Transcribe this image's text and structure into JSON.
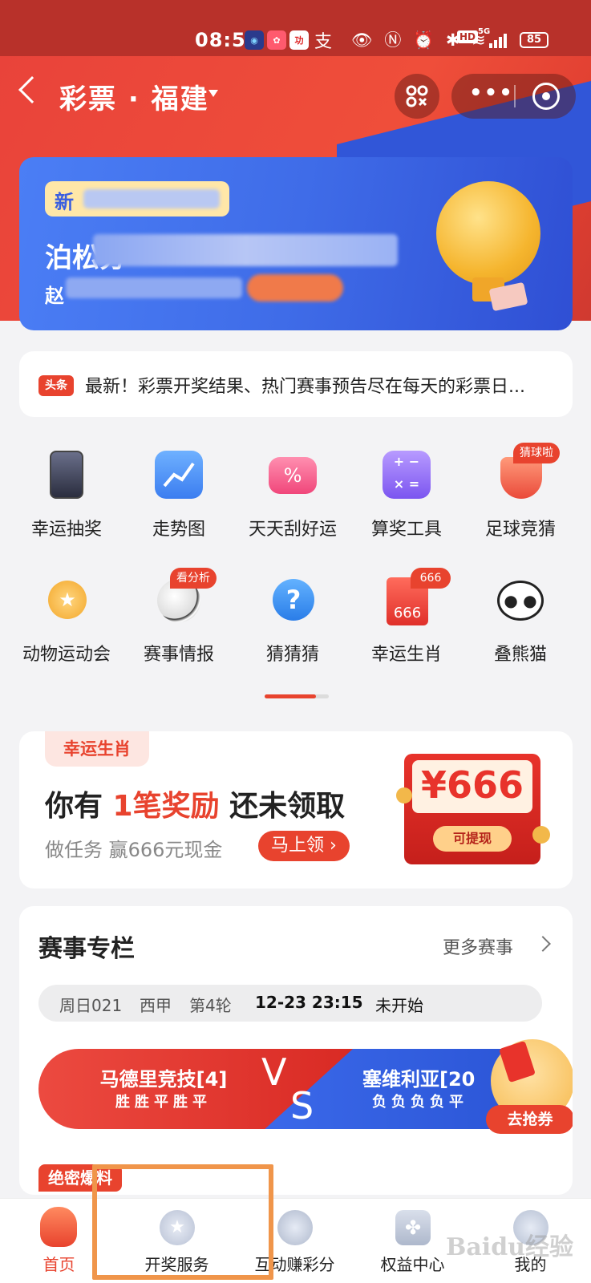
{
  "status_bar": {
    "time": "08:51",
    "battery": "85",
    "network": "5G",
    "hd": "HD"
  },
  "header": {
    "title": "彩票 · 福建"
  },
  "banner": {
    "tag": "新",
    "line1": "泊松分",
    "line2": "赵"
  },
  "news": {
    "badge": "头条",
    "text": "最新！彩票开奖结果、热门赛事预告尽在每天的彩票日..."
  },
  "grid": {
    "row1": [
      {
        "label": "幸运抽奖",
        "icon": "phone-icon"
      },
      {
        "label": "走势图",
        "icon": "trend-chart-icon"
      },
      {
        "label": "天天刮好运",
        "icon": "scratch-ticket-icon"
      },
      {
        "label": "算奖工具",
        "icon": "calculator-icon"
      },
      {
        "label": "足球竞猜",
        "icon": "trophy-icon",
        "badge": "猜球啦"
      }
    ],
    "row2": [
      {
        "label": "动物运动会",
        "icon": "medal-icon"
      },
      {
        "label": "赛事情报",
        "icon": "soccer-ball-icon",
        "badge": "看分析"
      },
      {
        "label": "猜猜猜",
        "icon": "question-icon"
      },
      {
        "label": "幸运生肖",
        "icon": "zodiac-card-icon",
        "badge": "666",
        "card_text": "666"
      },
      {
        "label": "叠熊猫",
        "icon": "panda-icon"
      }
    ]
  },
  "reward": {
    "tag": "幸运生肖",
    "title_pre": "你有 ",
    "title_hl": "1笔奖励",
    "title_post": " 还未领取",
    "subtitle": "做任务 赢666元现金",
    "button": "马上领 ›",
    "amount": "¥666",
    "withdraw": "可提现"
  },
  "matches": {
    "title": "赛事专栏",
    "more": "更多赛事",
    "info": {
      "code": "周日021",
      "league": "西甲",
      "round": "第4轮",
      "datetime": "12-23 23:15",
      "status": "未开始"
    },
    "home": {
      "name": "马德里竞技[4]",
      "form": "胜胜平胜平"
    },
    "away": {
      "name": "塞维利亚[20",
      "form": "负负负负平"
    },
    "vs_v": "V",
    "vs_s": "S",
    "coupon": "去抢券",
    "exclusive": "绝密爆料"
  },
  "tabbar": [
    {
      "label": "首页",
      "icon": "home-mascot-icon",
      "active": true
    },
    {
      "label": "开奖服务",
      "icon": "star-ball-icon"
    },
    {
      "label": "互动赚彩分",
      "icon": "planet-icon"
    },
    {
      "label": "权益中心",
      "icon": "clover-icon"
    },
    {
      "label": "我的",
      "icon": "user-icon"
    }
  ],
  "watermark": "Baidu经验",
  "colors": {
    "brand_red": "#e8432e",
    "banner_blue": "#3f6ce8",
    "highlight_orange": "#f0954a"
  }
}
